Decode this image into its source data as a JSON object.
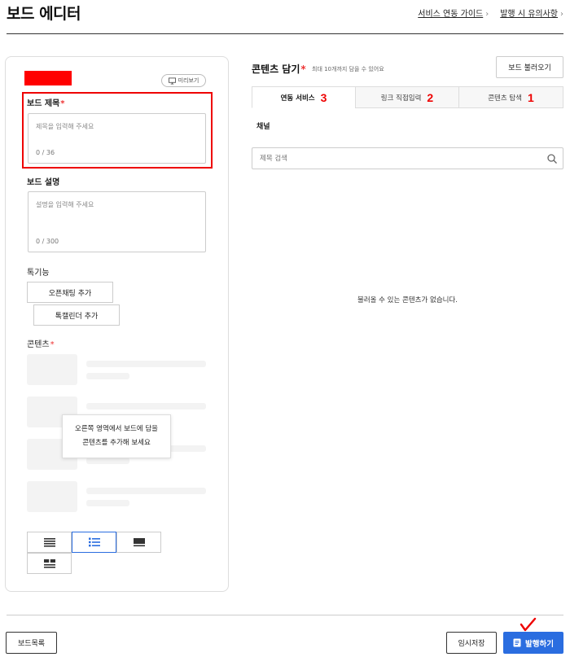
{
  "header": {
    "title": "보드 에디터",
    "links": [
      {
        "label": "서비스 연동 가이드"
      },
      {
        "label": "발행 시 유의사항"
      }
    ]
  },
  "left": {
    "preview_label": "미리보기",
    "title_field": {
      "label": "보드 제목",
      "placeholder": "제목을 입력해 주세요",
      "counter": "0 / 36"
    },
    "desc_field": {
      "label": "보드 설명",
      "placeholder": "설명을 입력해 주세요",
      "counter": "0 / 300"
    },
    "features": {
      "label": "톡기능",
      "open_chat_btn": "오픈채팅 추가",
      "calendar_btn": "톡캘린더 추가"
    },
    "contents": {
      "label": "콘텐츠",
      "tooltip_line1": "오른쪽 영역에서 보드에 담을",
      "tooltip_line2": "콘텐츠를 추가해 보세요"
    },
    "required_mark": "*"
  },
  "right": {
    "title": "콘텐츠 담기",
    "hint": "최대 10개까지 담을 수 있어요",
    "load_button": "보드 불러오기",
    "tabs": [
      {
        "label": "연동 서비스",
        "number": "3"
      },
      {
        "label": "링크 직접입력",
        "number": "2"
      },
      {
        "label": "콘텐츠 탐색",
        "number": "1"
      }
    ],
    "channel_label": "채널",
    "search_placeholder": "제목 검색",
    "empty_message": "불러올 수 있는 콘텐츠가 없습니다."
  },
  "footer": {
    "list_button": "보드목록",
    "temp_save_button": "임시저장",
    "publish_button": "발행하기"
  },
  "colors": {
    "accent": "#2a6de0",
    "highlight": "#ff0000",
    "required": "#e33333"
  }
}
